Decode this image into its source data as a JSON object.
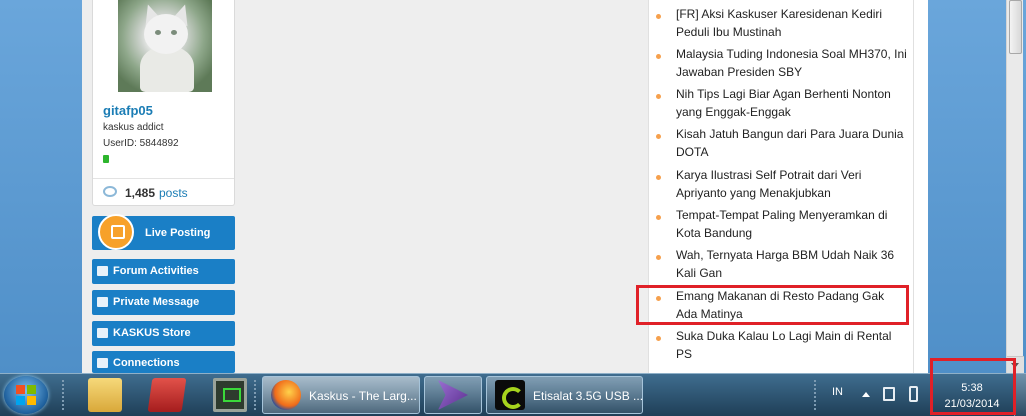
{
  "profile": {
    "username": "gitafp05",
    "user_title": "kaskus addict",
    "user_id": "UserID: 5844892",
    "post_count": "1,485",
    "posts_label": "posts"
  },
  "menu": [
    {
      "label": "Live Posting",
      "icon": "live-posting-icon"
    },
    {
      "label": "Forum Activities",
      "icon": "forum-activities-icon"
    },
    {
      "label": "Private Message",
      "icon": "private-message-icon"
    },
    {
      "label": "KASKUS Store",
      "icon": "store-cart-icon"
    },
    {
      "label": "Connections",
      "icon": "connections-icon"
    }
  ],
  "news": [
    "[FR] Aksi Kaskuser Karesidenan Kediri Peduli Ibu Mustinah",
    "Malaysia Tuding Indonesia Soal MH370, Ini Jawaban Presiden SBY",
    "Nih Tips Lagi Biar Agan Berhenti Nonton yang Enggak-Enggak",
    "Kisah Jatuh Bangun dari Para Juara Dunia DOTA",
    "Karya Ilustrasi Self Potrait dari Veri Apriyanto yang Menakjubkan",
    "Tempat-Tempat Paling Menyeramkan di Kota Bandung",
    "Wah, Ternyata Harga BBM Udah Naik 36 Kali Gan",
    "Emang Makanan di Resto Padang Gak Ada Matinya",
    "Suka Duka Kalau Lo Lagi Main di Rental PS"
  ],
  "taskbar": {
    "tasks": [
      {
        "label": "Kaskus - The Larg...",
        "icon": "firefox-icon"
      },
      {
        "label": "",
        "icon": "visual-studio-icon"
      },
      {
        "label": "Etisalat 3.5G USB ...",
        "icon": "etisalat-modem-icon"
      }
    ],
    "language": "IN",
    "time": "5:38",
    "date": "21/03/2014"
  },
  "colors": {
    "accent_blue": "#1a7fc6",
    "highlight_red": "#e02027",
    "bullet_orange": "#f6a04d"
  }
}
